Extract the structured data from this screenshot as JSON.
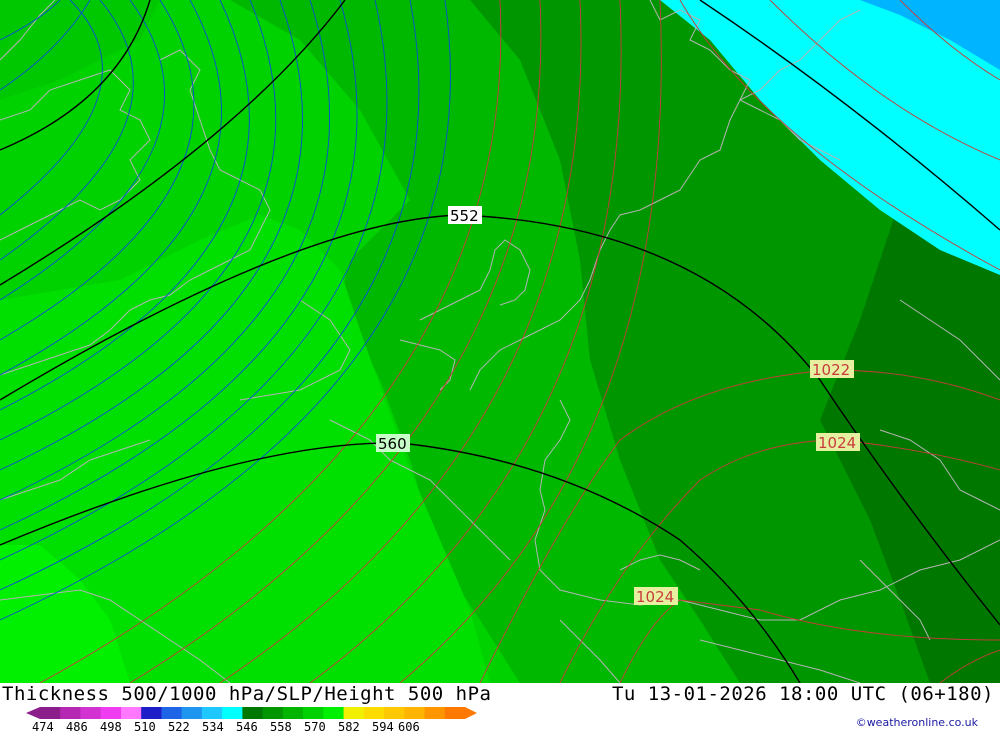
{
  "map": {
    "thickness_labels": [
      "552",
      "560"
    ],
    "pressure_labels": [
      "1022",
      "1024",
      "1024"
    ],
    "colors": {
      "band_light": "#00ee00",
      "band_mid1": "#00d200",
      "band_mid2": "#00b800",
      "band_mid3": "#009600",
      "band_dark": "#007800",
      "cold_cyan": "#00ffff",
      "cold_sky": "#00b4ff",
      "thickness_line": "#000000",
      "slp_line": "#c83c3c",
      "height_line": "#0050d0",
      "coast_line": "#b4b4b4"
    }
  },
  "footer": {
    "title": "Thickness 500/1000 hPa/SLP/Height 500 hPa",
    "datetime": "Tu 13-01-2026 18:00 UTC (06+180)",
    "credit": "©weatheronline.co.uk"
  },
  "legend": {
    "ticks": [
      "474",
      "486",
      "498",
      "510",
      "522",
      "534",
      "546",
      "558",
      "570",
      "582",
      "594",
      "606"
    ],
    "colors": [
      "#8c1e8c",
      "#b428b4",
      "#d232d2",
      "#f03cf0",
      "#ff78ff",
      "#1e1ec8",
      "#1e64e6",
      "#1e96f0",
      "#1ec8ff",
      "#00ffff",
      "#007800",
      "#009600",
      "#00b400",
      "#00d200",
      "#00f000",
      "#f0f000",
      "#ffdc00",
      "#ffc800",
      "#ffb400",
      "#ff9600",
      "#ff7800"
    ]
  }
}
